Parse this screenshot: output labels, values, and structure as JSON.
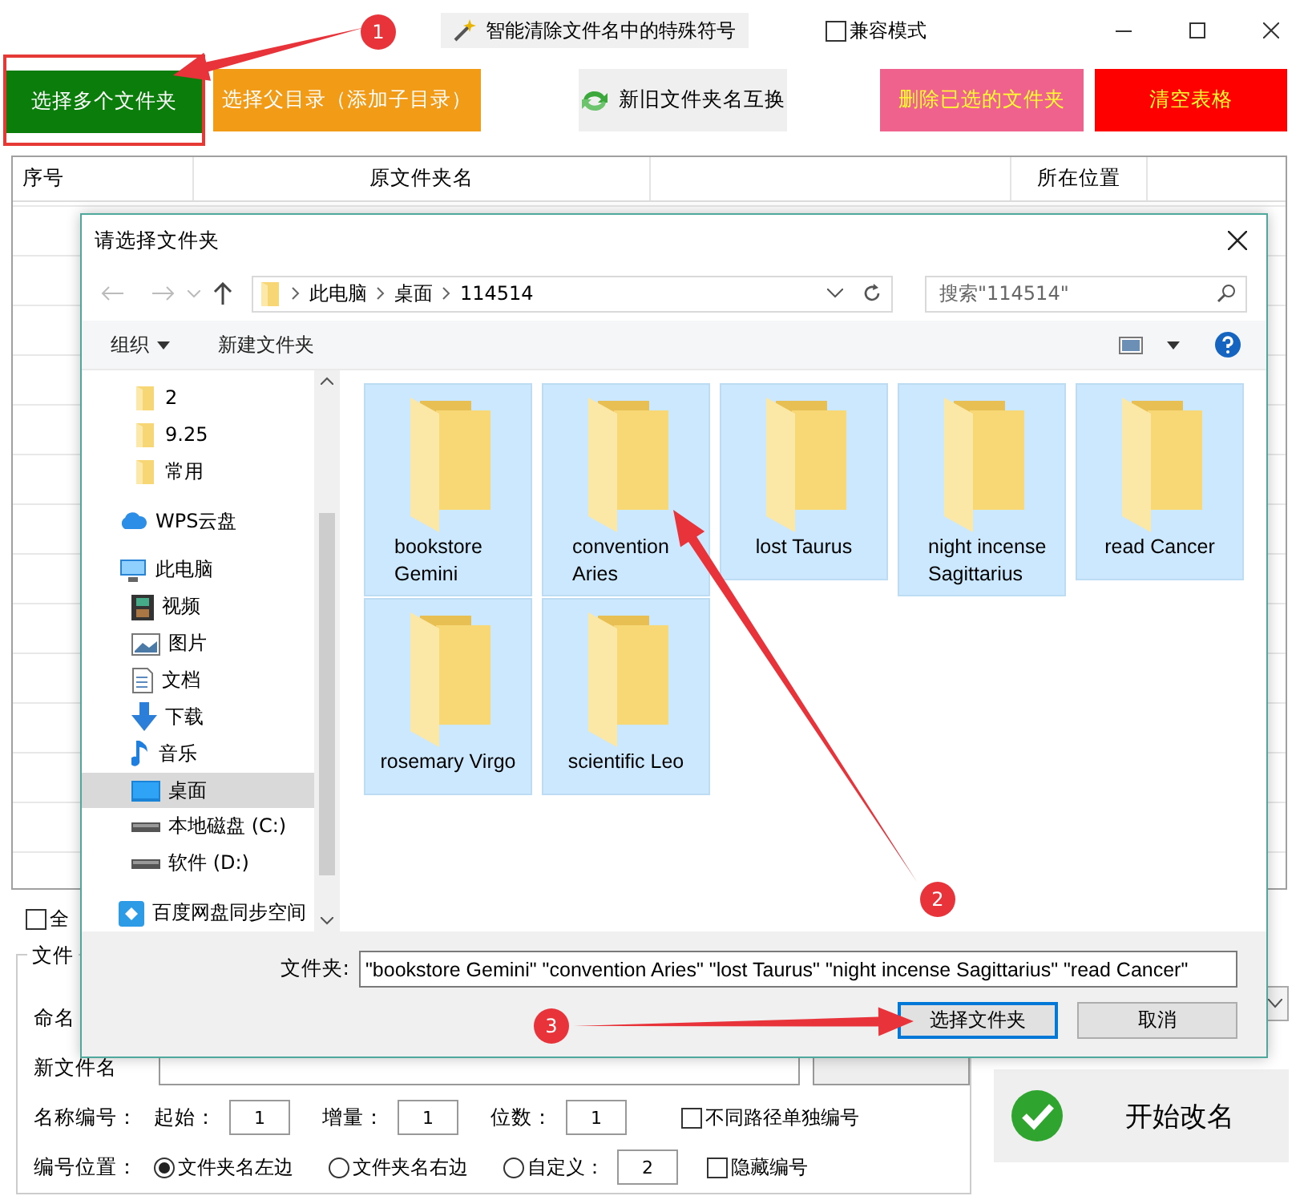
{
  "app": {
    "title": "智能清除文件名中的特殊符号",
    "compat_mode": {
      "label": "兼容模式",
      "checked": false
    }
  },
  "toolbar": [
    {
      "label": "选择多个文件夹",
      "kind": "green",
      "highlighted": true
    },
    {
      "label": "选择父目录（添加子目录）",
      "kind": "orange",
      "highlighted": false
    },
    {
      "label": "新旧文件夹名互换",
      "kind": "swap",
      "highlighted": false
    },
    {
      "label": "删除已选的文件夹",
      "kind": "pink",
      "highlighted": false
    },
    {
      "label": "清空表格",
      "kind": "red",
      "highlighted": false
    }
  ],
  "table": {
    "columns": [
      {
        "kind": "text",
        "label": "序号"
      },
      {
        "kind": "text",
        "label": "原文件夹名"
      },
      {
        "kind": "blank"
      },
      {
        "kind": "text",
        "label": "所在位置"
      }
    ]
  },
  "select_all": {
    "label": "全",
    "checked": false
  },
  "group": {
    "title": "文件",
    "naming_label": "命名",
    "new_name_label": "新文件名",
    "numbering": {
      "label": "名称编号：",
      "fields": [
        {
          "label": "起始：",
          "value": "1"
        },
        {
          "label": "增量：",
          "value": "1"
        },
        {
          "label": "位数：",
          "value": "1"
        }
      ],
      "separate": {
        "label": "不同路径单独编号",
        "checked": false
      }
    },
    "position": {
      "label": "编号位置：",
      "options": [
        {
          "label": "文件夹名左边",
          "selected": true
        },
        {
          "label": "文件夹名右边",
          "selected": false
        },
        {
          "label": "自定义：",
          "selected": false,
          "value": "2"
        }
      ],
      "hide": {
        "label": "隐藏编号",
        "checked": false
      }
    }
  },
  "start_button": "开始改名",
  "dialog": {
    "title": "请选择文件夹",
    "path": [
      "此电脑",
      "桌面",
      "114514"
    ],
    "search": {
      "placeholder": "搜索\"114514\""
    },
    "toolbar": [
      "组织",
      "新建文件夹"
    ],
    "tree": [
      {
        "label": "2",
        "kind": "folder",
        "selected": false
      },
      {
        "label": "9.25",
        "kind": "folder",
        "selected": false
      },
      {
        "label": "常用",
        "kind": "folder",
        "selected": false
      },
      {
        "label": "WPS云盘",
        "kind": "cloud",
        "selected": false
      },
      {
        "label": "此电脑",
        "kind": "computer",
        "selected": false,
        "children": [
          {
            "label": "视频",
            "kind": "video",
            "selected": false
          },
          {
            "label": "图片",
            "kind": "picture",
            "selected": false
          },
          {
            "label": "文档",
            "kind": "document",
            "selected": false
          },
          {
            "label": "下载",
            "kind": "download",
            "selected": false
          },
          {
            "label": "音乐",
            "kind": "music",
            "selected": false
          },
          {
            "label": "桌面",
            "kind": "desktop",
            "selected": true
          },
          {
            "label": "本地磁盘 (C:)",
            "kind": "drive",
            "selected": false
          },
          {
            "label": "软件 (D:)",
            "kind": "drive",
            "selected": false
          }
        ]
      },
      {
        "label": "百度网盘同步空间",
        "kind": "sync",
        "selected": false
      }
    ],
    "folders": [
      {
        "name": "bookstore Gemini",
        "selected": true
      },
      {
        "name": "convention Aries",
        "selected": true
      },
      {
        "name": "lost Taurus",
        "selected": true
      },
      {
        "name": "night incense Sagittarius",
        "selected": true
      },
      {
        "name": "read Cancer",
        "selected": true
      },
      {
        "name": "rosemary Virgo",
        "selected": true
      },
      {
        "name": "scientific Leo",
        "selected": true
      }
    ],
    "filename": {
      "label": "文件夹:",
      "value": "\"bookstore Gemini\" \"convention Aries\" \"lost Taurus\" \"night incense Sagittarius\" \"read Cancer\""
    },
    "buttons": [
      {
        "label": "选择文件夹",
        "focused": true
      },
      {
        "label": "取消",
        "focused": false
      }
    ]
  },
  "annotations": [
    {
      "label": "1"
    },
    {
      "label": "2"
    },
    {
      "label": "3"
    }
  ]
}
